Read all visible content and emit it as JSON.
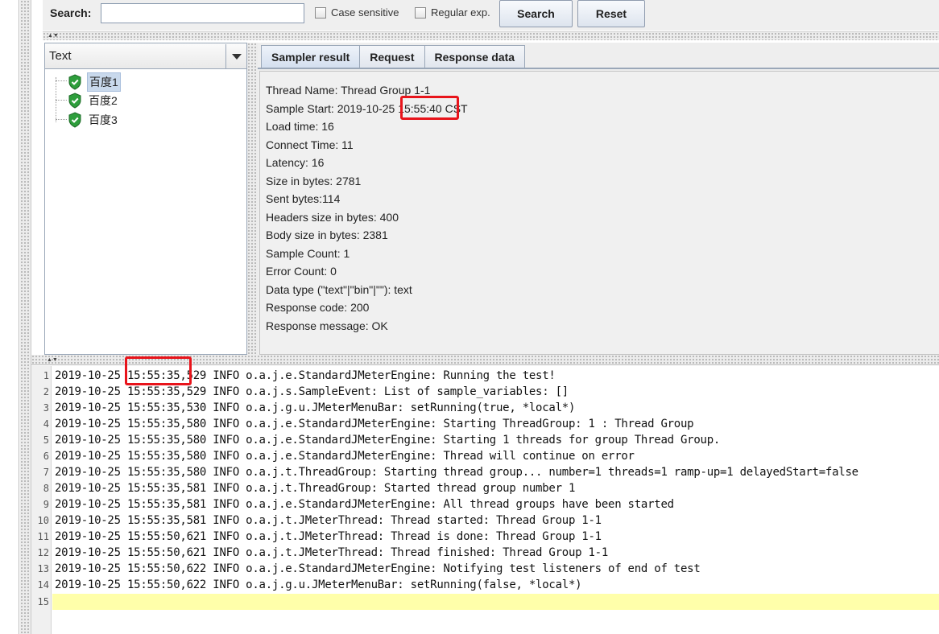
{
  "search": {
    "label": "Search:",
    "value": "",
    "case_sensitive_label": "Case sensitive",
    "regular_exp_label": "Regular exp.",
    "search_button": "Search",
    "reset_button": "Reset"
  },
  "renderer": {
    "selected": "Text"
  },
  "tree": {
    "items": [
      {
        "label": "百度1",
        "selected": true
      },
      {
        "label": "百度2",
        "selected": false
      },
      {
        "label": "百度3",
        "selected": false
      }
    ]
  },
  "tabs": [
    {
      "label": "Sampler result",
      "active": true
    },
    {
      "label": "Request",
      "active": false
    },
    {
      "label": "Response data",
      "active": false
    }
  ],
  "sampler_result": [
    "Thread Name: Thread Group 1-1",
    "Sample Start: 2019-10-25 15:55:40 CST",
    "Load time: 16",
    "Connect Time: 11",
    "Latency: 16",
    "Size in bytes: 2781",
    "Sent bytes:114",
    "Headers size in bytes: 400",
    "Body size in bytes: 2381",
    "Sample Count: 1",
    "Error Count: 0",
    "Data type (\"text\"|\"bin\"|\"\"): text",
    "Response code: 200",
    "Response message: OK"
  ],
  "log": {
    "lines": [
      "2019-10-25 15:55:35,529 INFO o.a.j.e.StandardJMeterEngine: Running the test!",
      "2019-10-25 15:55:35,529 INFO o.a.j.s.SampleEvent: List of sample_variables: []",
      "2019-10-25 15:55:35,530 INFO o.a.j.g.u.JMeterMenuBar: setRunning(true, *local*)",
      "2019-10-25 15:55:35,580 INFO o.a.j.e.StandardJMeterEngine: Starting ThreadGroup: 1 : Thread Group",
      "2019-10-25 15:55:35,580 INFO o.a.j.e.StandardJMeterEngine: Starting 1 threads for group Thread Group.",
      "2019-10-25 15:55:35,580 INFO o.a.j.e.StandardJMeterEngine: Thread will continue on error",
      "2019-10-25 15:55:35,580 INFO o.a.j.t.ThreadGroup: Starting thread group... number=1 threads=1 ramp-up=1 delayedStart=false",
      "2019-10-25 15:55:35,581 INFO o.a.j.t.ThreadGroup: Started thread group number 1",
      "2019-10-25 15:55:35,581 INFO o.a.j.e.StandardJMeterEngine: All thread groups have been started",
      "2019-10-25 15:55:35,581 INFO o.a.j.t.JMeterThread: Thread started: Thread Group 1-1",
      "2019-10-25 15:55:50,621 INFO o.a.j.t.JMeterThread: Thread is done: Thread Group 1-1",
      "2019-10-25 15:55:50,621 INFO o.a.j.t.JMeterThread: Thread finished: Thread Group 1-1",
      "2019-10-25 15:55:50,622 INFO o.a.j.e.StandardJMeterEngine: Notifying test listeners of end of test",
      "2019-10-25 15:55:50,622 INFO o.a.j.g.u.JMeterMenuBar: setRunning(false, *local*)",
      ""
    ]
  },
  "colors": {
    "highlight_box": "#e8141b",
    "current_line": "#ffffaa",
    "shield_green": "#2e9e3c"
  },
  "icons": {
    "tree_item": "green-check-shield-icon",
    "combo": "chevron-down-icon"
  }
}
